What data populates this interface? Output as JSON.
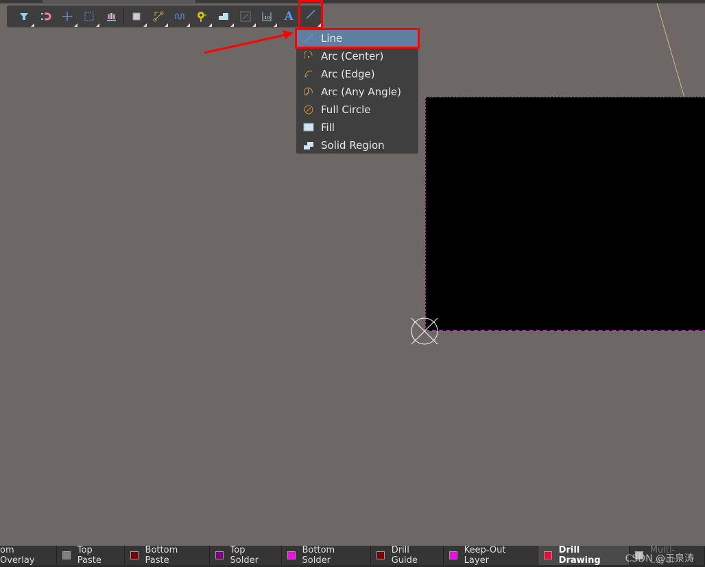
{
  "toolbar": {
    "items": [
      {
        "icon": "filter-icon"
      },
      {
        "icon": "magnet-icon"
      },
      {
        "icon": "crosshair-icon"
      },
      {
        "icon": "select-rect-icon"
      },
      {
        "icon": "align-icon"
      },
      {
        "icon": "component-icon"
      },
      {
        "icon": "route-icon"
      },
      {
        "icon": "diff-pair-icon"
      },
      {
        "icon": "via-icon"
      },
      {
        "icon": "region-icon"
      },
      {
        "icon": "keepout-icon"
      },
      {
        "icon": "dimension-icon"
      },
      {
        "icon": "text-icon",
        "label": "A"
      },
      {
        "icon": "line-icon"
      }
    ]
  },
  "menu": {
    "items": [
      {
        "label": "Line",
        "icon": "line-icon",
        "selected": true
      },
      {
        "label": "Arc (Center)",
        "icon": "arc-center-icon"
      },
      {
        "label": "Arc (Edge)",
        "icon": "arc-edge-icon"
      },
      {
        "label": "Arc (Any Angle)",
        "icon": "arc-any-angle-icon"
      },
      {
        "label": "Full Circle",
        "icon": "full-circle-icon"
      },
      {
        "label": "Fill",
        "icon": "fill-icon"
      },
      {
        "label": "Solid Region",
        "icon": "solid-region-icon"
      }
    ]
  },
  "layers": [
    {
      "label": "om Overlay",
      "color": null
    },
    {
      "label": "Top Paste",
      "color": "#808080"
    },
    {
      "label": "Bottom Paste",
      "color": "#800000"
    },
    {
      "label": "Top Solder",
      "color": "#800080"
    },
    {
      "label": "Bottom Solder",
      "color": "#ff00ff"
    },
    {
      "label": "Drill Guide",
      "color": "#800000"
    },
    {
      "label": "Keep-Out Layer",
      "color": "#ff00ff"
    },
    {
      "label": "Drill Drawing",
      "color": "#ff0033",
      "active": true
    },
    {
      "label": "Multi-Layer",
      "color": "#c0c0c0"
    }
  ],
  "watermark": "CSDN @王泉涛",
  "colors": {
    "highlight": "#ff0000",
    "menu_selected": "#5f7fa0",
    "canvas": "#6d6866"
  }
}
